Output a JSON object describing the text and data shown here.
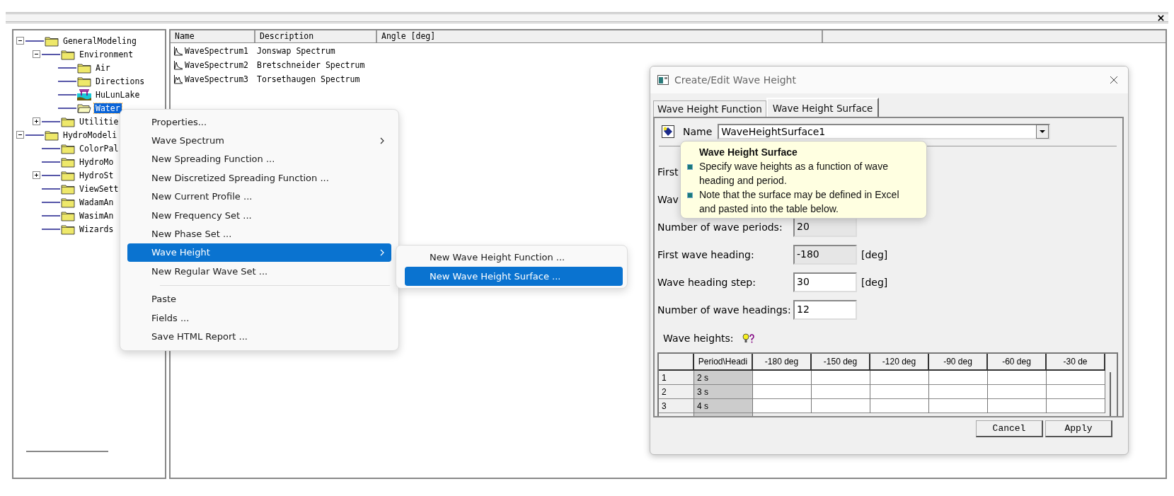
{
  "tree": [
    {
      "label": "GeneralModeling",
      "kind": "folder",
      "expanded": true,
      "selected": false,
      "children": [
        {
          "label": "Environment",
          "kind": "folder",
          "expanded": true,
          "selected": false,
          "children": [
            {
              "label": "Air",
              "kind": "folder",
              "selected": false
            },
            {
              "label": "Directions",
              "kind": "folder",
              "selected": false
            },
            {
              "label": "HuLunLake",
              "kind": "lake",
              "selected": false
            },
            {
              "label": "Water",
              "kind": "open-folder",
              "selected": true
            }
          ]
        },
        {
          "label": "Utilitie",
          "kind": "folder",
          "expanded": false,
          "selected": false
        }
      ]
    },
    {
      "label": "HydroModeli",
      "kind": "folder",
      "expanded": true,
      "selected": false,
      "children": [
        {
          "label": "ColorPal",
          "kind": "folder",
          "selected": false
        },
        {
          "label": "HydroMo",
          "kind": "folder",
          "selected": false
        },
        {
          "label": "HydroSt",
          "kind": "folder",
          "expanded": false,
          "selected": false
        },
        {
          "label": "ViewSett",
          "kind": "folder",
          "selected": false
        },
        {
          "label": "WadamAn",
          "kind": "folder",
          "selected": false
        },
        {
          "label": "WasimAn",
          "kind": "folder",
          "selected": false
        },
        {
          "label": "Wizards",
          "kind": "folder",
          "selected": false
        }
      ]
    }
  ],
  "list": {
    "columns": [
      "Name",
      "Description",
      "Angle [deg]"
    ],
    "rows": [
      {
        "name": "WaveSpectrum1",
        "description": "Jonswap Spectrum",
        "kind": "single-peak"
      },
      {
        "name": "WaveSpectrum2",
        "description": "Bretschneider Spectrum",
        "kind": "single-peak"
      },
      {
        "name": "WaveSpectrum3",
        "description": "Torsethaugen Spectrum",
        "kind": "double-peak"
      }
    ]
  },
  "context_menu": {
    "items": [
      {
        "kind": "item",
        "label": "Properties...",
        "submenu": false,
        "selected": false
      },
      {
        "kind": "item",
        "label": "Wave Spectrum",
        "submenu": true,
        "selected": false
      },
      {
        "kind": "item",
        "label": "New Spreading Function ...",
        "submenu": false,
        "selected": false
      },
      {
        "kind": "item",
        "label": "New Discretized Spreading Function ...",
        "submenu": false,
        "selected": false
      },
      {
        "kind": "item",
        "label": "New Current Profile ...",
        "submenu": false,
        "selected": false
      },
      {
        "kind": "item",
        "label": "New Frequency Set ...",
        "submenu": false,
        "selected": false
      },
      {
        "kind": "item",
        "label": "New Phase Set ...",
        "submenu": false,
        "selected": false
      },
      {
        "kind": "item",
        "label": "Wave Height",
        "submenu": true,
        "selected": true
      },
      {
        "kind": "item",
        "label": "New Regular Wave Set ...",
        "submenu": false,
        "selected": false
      },
      {
        "kind": "separator"
      },
      {
        "kind": "item",
        "label": "Paste",
        "submenu": false,
        "selected": false
      },
      {
        "kind": "item",
        "label": "Fields ...",
        "submenu": false,
        "selected": false
      },
      {
        "kind": "item",
        "label": "Save HTML Report ...",
        "submenu": false,
        "selected": false
      }
    ]
  },
  "submenu": {
    "items": [
      {
        "label": "New Wave Height Function ...",
        "selected": false
      },
      {
        "label": "New Wave Height Surface ...",
        "selected": true
      }
    ]
  },
  "dialog": {
    "title": "Create/Edit Wave Height",
    "tabs": [
      {
        "label": "Wave Height Function",
        "selected": false
      },
      {
        "label": "Wave Height Surface",
        "selected": true
      }
    ],
    "name_label": "Name",
    "name_value": "WaveHeightSurface1",
    "fields": [
      {
        "label": "First"
      },
      {
        "label": "Wav"
      },
      {
        "label": "Number of wave periods:",
        "value": "20",
        "disabled": true
      },
      {
        "label": "First wave heading:",
        "value": "-180",
        "unit": "[deg]",
        "disabled": true
      },
      {
        "label": "Wave heading step:",
        "value": "30",
        "unit": "[deg]",
        "disabled": false
      },
      {
        "label": "Number of wave headings:",
        "value": "12",
        "disabled": false
      }
    ],
    "table_label": "Wave heights:",
    "table": {
      "columns": [
        "Period\\Headi",
        "-180 deg",
        "-150 deg",
        "-120 deg",
        "-90 deg",
        "-60 deg",
        "-30 de"
      ],
      "rows": [
        {
          "index": "1",
          "period": "2 s"
        },
        {
          "index": "2",
          "period": "3 s"
        },
        {
          "index": "3",
          "period": "4 s"
        }
      ]
    },
    "buttons": [
      "Cancel",
      "Apply"
    ]
  },
  "tooltip": {
    "title": "Wave Height Surface",
    "bullets": [
      "Specify wave heights as a function of wave heading and period.",
      "Note that the surface may be defined in Excel and pasted into the table below."
    ]
  }
}
